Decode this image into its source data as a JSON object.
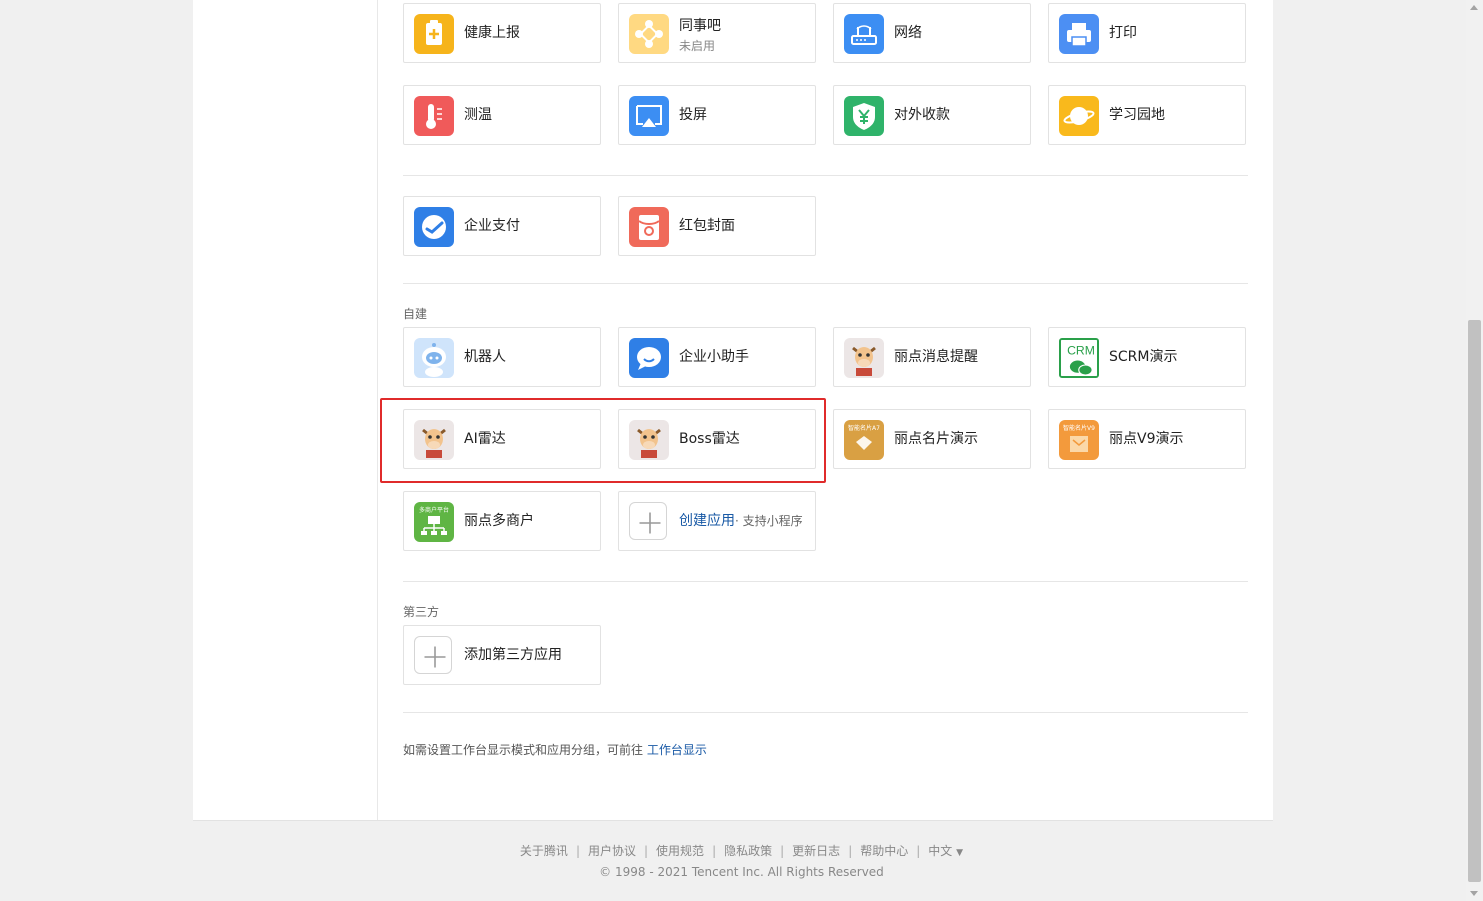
{
  "top_apps": [
    {
      "label": "健康上报",
      "icon": "health-report-icon"
    },
    {
      "label": "同事吧",
      "sublabel": "未启用",
      "icon": "colleague-bar-icon"
    },
    {
      "label": "网络",
      "icon": "network-icon"
    },
    {
      "label": "打印",
      "icon": "printer-icon"
    },
    {
      "label": "测温",
      "icon": "thermometer-icon"
    },
    {
      "label": "投屏",
      "icon": "screen-cast-icon"
    },
    {
      "label": "对外收款",
      "icon": "payment-shield-icon"
    },
    {
      "label": "学习园地",
      "icon": "study-planet-icon"
    }
  ],
  "pay_apps": [
    {
      "label": "企业支付",
      "icon": "enterprise-pay-icon"
    },
    {
      "label": "红包封面",
      "icon": "red-packet-icon"
    }
  ],
  "custom_section": {
    "title": "自建",
    "apps": [
      {
        "label": "机器人",
        "icon": "robot-icon"
      },
      {
        "label": "企业小助手",
        "icon": "chat-bubble-icon"
      },
      {
        "label": "丽点消息提醒",
        "icon": "cow-mascot-icon"
      },
      {
        "label": "SCRM演示",
        "icon": "crm-icon",
        "icon_text": "CRM"
      },
      {
        "label": "AI雷达",
        "icon": "cow-mascot-icon"
      },
      {
        "label": "Boss雷达",
        "icon": "cow-mascot-icon"
      },
      {
        "label": "丽点名片演示",
        "icon": "business-card-icon",
        "icon_text": "智能名片A7"
      },
      {
        "label": "丽点V9演示",
        "icon": "v9-demo-icon",
        "icon_text": "智能名片V9"
      },
      {
        "label": "丽点多商户",
        "icon": "multi-merchant-icon",
        "icon_text": "多商户平台"
      }
    ],
    "create": {
      "label": "创建应用",
      "hint": "· 支持小程序",
      "icon": "plus-icon"
    }
  },
  "third_party_section": {
    "title": "第三方",
    "add": {
      "label": "添加第三方应用",
      "icon": "plus-icon"
    }
  },
  "workbench_note": {
    "text": "如需设置工作台显示模式和应用分组，可前往",
    "link": "工作台显示"
  },
  "footer": {
    "links": [
      "关于腾讯",
      "用户协议",
      "使用规范",
      "隐私政策",
      "更新日志",
      "帮助中心"
    ],
    "language": "中文",
    "copyright": "© 1998 - 2021 Tencent Inc. All Rights Reserved"
  },
  "colors": {
    "highlight_border": "#e02b2b",
    "link_blue": "#1a5aa6"
  }
}
